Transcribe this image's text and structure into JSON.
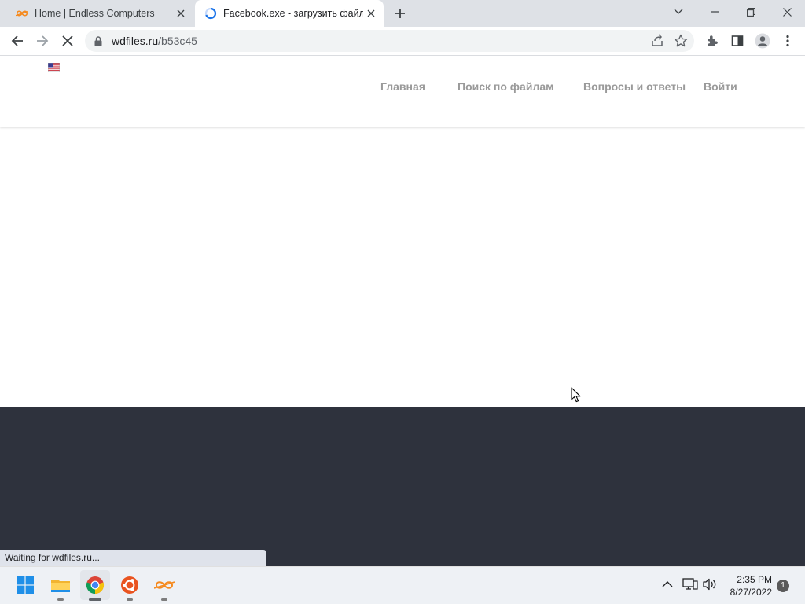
{
  "browser": {
    "tabs": [
      {
        "title": "Home | Endless Computers",
        "active": false
      },
      {
        "title": "Facebook.exe - загрузить файл",
        "active": true
      }
    ],
    "address": {
      "host": "wdfiles.ru",
      "path": "/b53c45"
    },
    "status_text": "Waiting for wdfiles.ru..."
  },
  "site": {
    "nav": [
      {
        "label": "Главная",
        "icon": "",
        "icon_after": true
      },
      {
        "label": "Поиск по файлам",
        "icon": "",
        "icon_after": true
      },
      {
        "label": "Вопросы и ответы"
      },
      {
        "label": "Войти",
        "icon": "",
        "icon_before": true
      }
    ],
    "language_icon": "us-flag-icon"
  },
  "taskbar": {
    "apps": [
      "start-icon",
      "file-explorer-icon",
      "chrome-icon",
      "ubuntu-icon",
      "endless-icon"
    ],
    "clock": {
      "time": "2:35 PM",
      "date": "8/27/2022"
    },
    "notification_count": "1"
  },
  "colors": {
    "tabstrip": "#dee1e6",
    "footer": "#2e323d",
    "nav_text": "#9a9a9a",
    "endless_orange": "#f58a1f",
    "chrome_loading_blue": "#1a73e8"
  }
}
